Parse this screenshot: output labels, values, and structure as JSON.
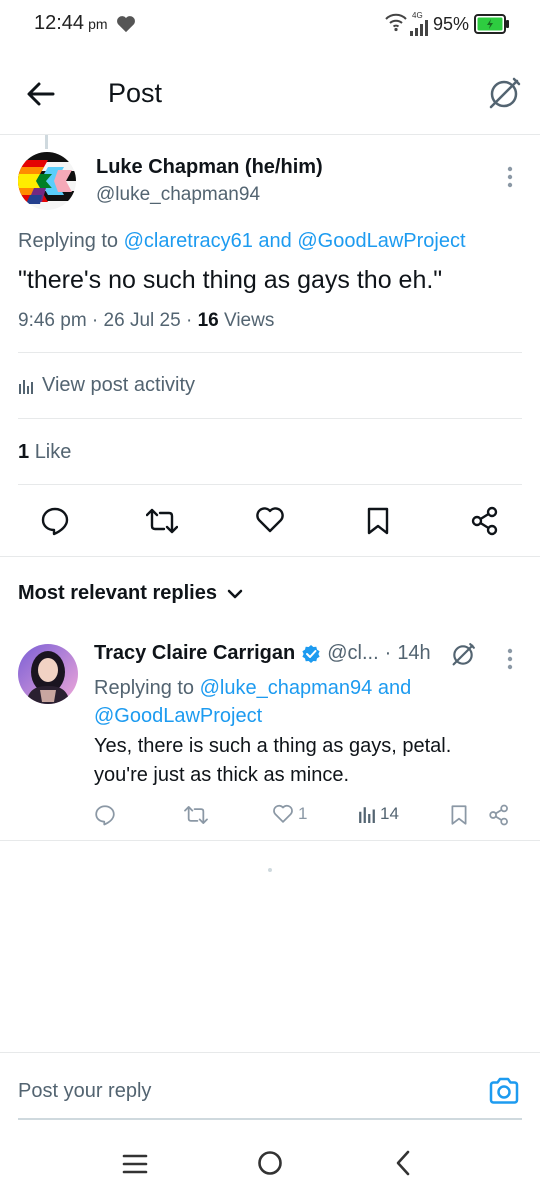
{
  "status_bar": {
    "time": "12:44",
    "ampm": "pm",
    "network": "4G",
    "battery": "95%"
  },
  "header": {
    "title": "Post"
  },
  "post": {
    "author_name": "Luke Chapman (he/him)",
    "author_handle": "@luke_chapman94",
    "replying_prefix": "Replying to ",
    "replying_link1": "@claretracy61",
    "replying_and": " and ",
    "replying_link2": "@GoodLawProject",
    "text": "\"there's no such thing as gays tho eh.\"",
    "time": "9:46 pm",
    "date": "26 Jul 25",
    "views_count": "16",
    "views_label": "Views",
    "activity_label": "View post activity",
    "likes_count": "1",
    "likes_label": "Like"
  },
  "replies": {
    "sort_label": "Most relevant replies",
    "items": [
      {
        "author_name": "Tracy Claire Carrigan",
        "handle": "@cl...",
        "time": "14h",
        "replying_prefix": "Replying to ",
        "replying_link1": "@luke_chapman94",
        "replying_and": " and",
        "replying_link2": "@GoodLawProject",
        "text_line1": "Yes, there is such a thing as gays, petal.",
        "text_line2": "you're just as thick as mince.",
        "likes": "1",
        "views": "14"
      }
    ]
  },
  "composer": {
    "placeholder": "Post your reply"
  },
  "colors": {
    "accent": "#1d9bf0",
    "text": "#0f1419",
    "secondary": "#536471",
    "battery": "#2ecc40"
  }
}
